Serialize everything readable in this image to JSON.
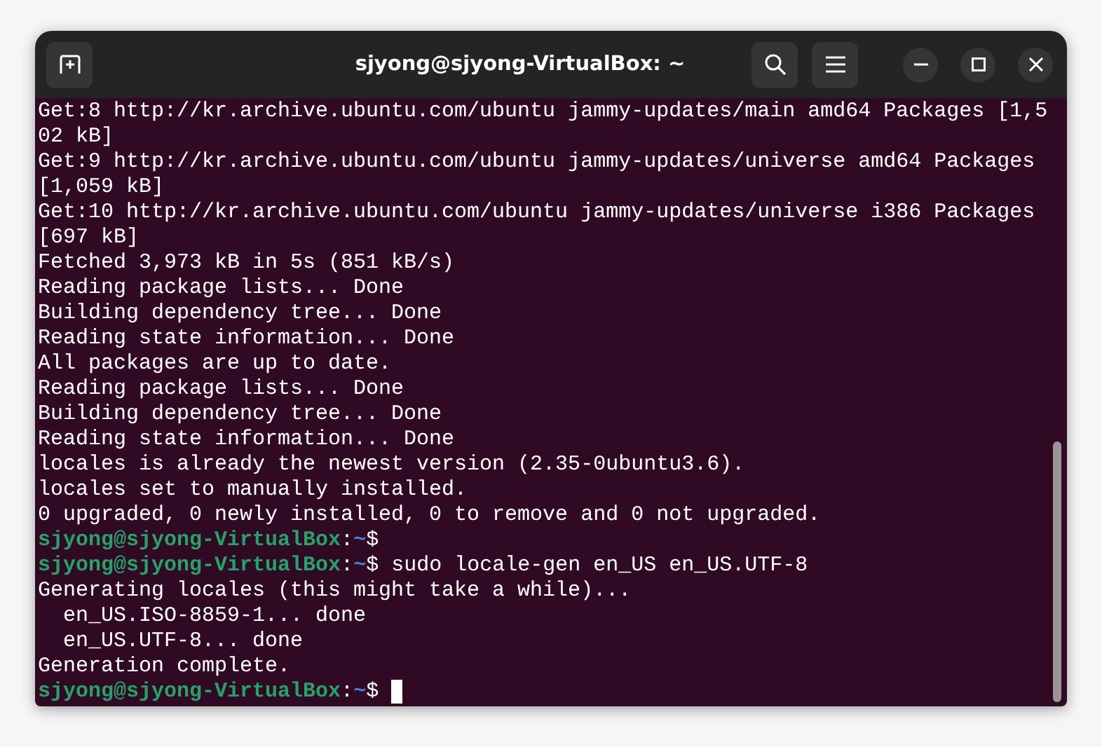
{
  "window": {
    "title": "sjyong@sjyong-VirtualBox: ~"
  },
  "terminal": {
    "cursor_visible": true,
    "lines": [
      {
        "kind": "output",
        "text": "Get:8 http://kr.archive.ubuntu.com/ubuntu jammy-updates/main amd64 Packages [1,5"
      },
      {
        "kind": "output",
        "text": "02 kB]"
      },
      {
        "kind": "output",
        "text": "Get:9 http://kr.archive.ubuntu.com/ubuntu jammy-updates/universe amd64 Packages"
      },
      {
        "kind": "output",
        "text": "[1,059 kB]"
      },
      {
        "kind": "output",
        "text": "Get:10 http://kr.archive.ubuntu.com/ubuntu jammy-updates/universe i386 Packages"
      },
      {
        "kind": "output",
        "text": "[697 kB]"
      },
      {
        "kind": "output",
        "text": "Fetched 3,973 kB in 5s (851 kB/s)"
      },
      {
        "kind": "output",
        "text": "Reading package lists... Done"
      },
      {
        "kind": "output",
        "text": "Building dependency tree... Done"
      },
      {
        "kind": "output",
        "text": "Reading state information... Done"
      },
      {
        "kind": "output",
        "text": "All packages are up to date."
      },
      {
        "kind": "output",
        "text": "Reading package lists... Done"
      },
      {
        "kind": "output",
        "text": "Building dependency tree... Done"
      },
      {
        "kind": "output",
        "text": "Reading state information... Done"
      },
      {
        "kind": "output",
        "text": "locales is already the newest version (2.35-0ubuntu3.6)."
      },
      {
        "kind": "output",
        "text": "locales set to manually installed."
      },
      {
        "kind": "output",
        "text": "0 upgraded, 0 newly installed, 0 to remove and 0 not upgraded."
      },
      {
        "kind": "prompt",
        "user": "sjyong@sjyong-VirtualBox",
        "sep": ":",
        "path": "~",
        "sign": "$"
      },
      {
        "kind": "prompt",
        "user": "sjyong@sjyong-VirtualBox",
        "sep": ":",
        "path": "~",
        "sign": "$",
        "command": "sudo locale-gen en_US en_US.UTF-8"
      },
      {
        "kind": "output",
        "text": "Generating locales (this might take a while)..."
      },
      {
        "kind": "output",
        "text": "  en_US.ISO-8859-1... done"
      },
      {
        "kind": "output",
        "text": "  en_US.UTF-8... done"
      },
      {
        "kind": "output",
        "text": "Generation complete."
      },
      {
        "kind": "prompt",
        "user": "sjyong@sjyong-VirtualBox",
        "sep": ":",
        "path": "~",
        "sign": "$"
      }
    ]
  }
}
